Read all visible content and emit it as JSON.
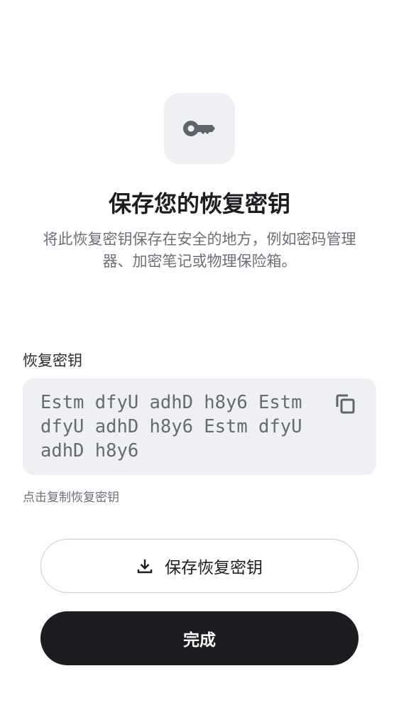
{
  "header": {
    "icon": "key-icon",
    "title": "保存您的恢复密钥",
    "subtitle": "将此恢复密钥保存在安全的地方，例如密码管理器、加密笔记或物理保险箱。"
  },
  "recovery_key": {
    "label": "恢复密钥",
    "value": "Estm dfyU adhD h8y6 Estm dfyU adhD h8y6 Estm dfyU adhD h8y6",
    "copy_icon": "copy-icon",
    "hint": "点击复制恢复密钥"
  },
  "actions": {
    "save_label": "保存恢复密钥",
    "save_icon": "download-icon",
    "done_label": "完成"
  },
  "colors": {
    "primary": "#1c1d21",
    "surface": "#eff0f3",
    "muted_text": "#6b6f78"
  }
}
